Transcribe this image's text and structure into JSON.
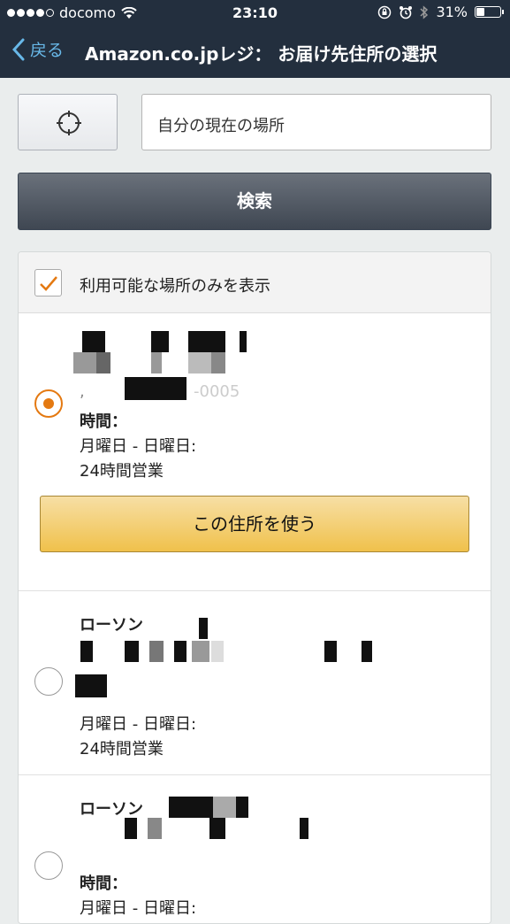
{
  "status_bar": {
    "carrier": "docomo",
    "time": "23:10",
    "battery": "31%",
    "battery_level": 0.31
  },
  "nav": {
    "back_label": "戻る",
    "title": "Amazon.co.jpレジ： お届け先住所の選択"
  },
  "search": {
    "location_placeholder": "自分の現在の場所",
    "search_button": "検索"
  },
  "filter": {
    "label": "利用可能な場所のみを表示",
    "checked": true
  },
  "stores": [
    {
      "name": "",
      "address_fragment": ",",
      "postal_fragment": "-0005",
      "hours_label": "時間：",
      "days": "月曜日 - 日曜日:",
      "hours": "24時間営業",
      "selected": true,
      "use_button": "この住所を使う"
    },
    {
      "name": "ローソン",
      "days": "月曜日 - 日曜日:",
      "hours": "24時間営業",
      "selected": false
    },
    {
      "name": "ローソン",
      "hours_label": "時間：",
      "days": "月曜日 - 日曜日:",
      "selected": false
    }
  ],
  "colors": {
    "nav_bg": "#232f3e",
    "back_link": "#68b8e8",
    "accent_orange": "#e47911",
    "use_button": "#f0c14b",
    "search_button": "#4a525d"
  }
}
